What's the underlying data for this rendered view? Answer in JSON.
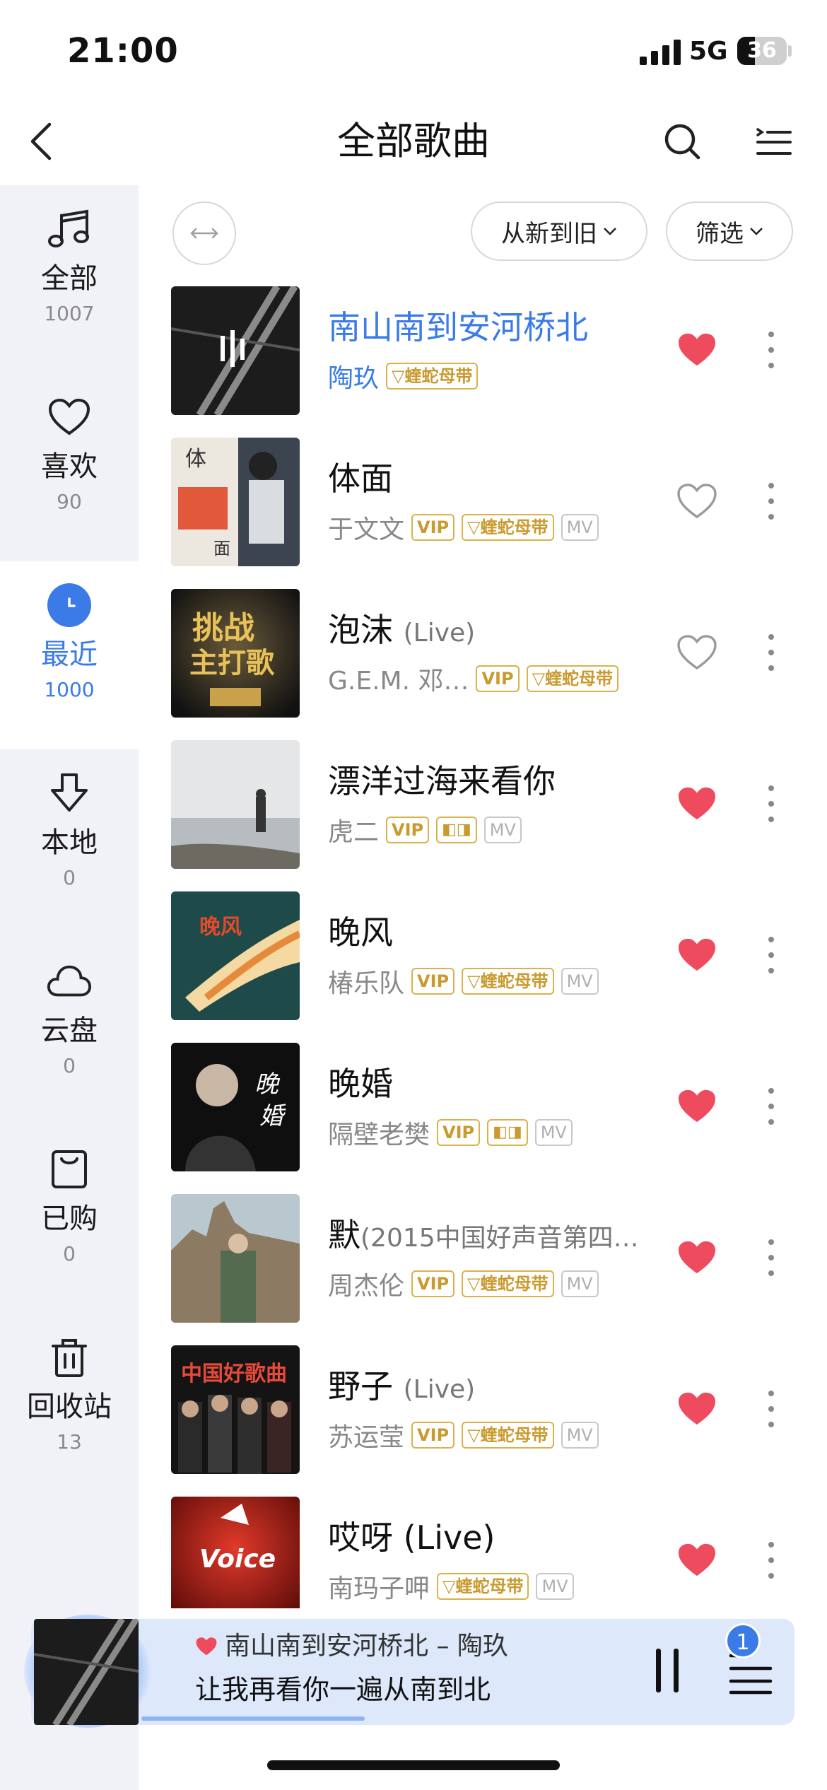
{
  "status_bar": {
    "time": "21:00",
    "network": "5G",
    "battery": "36"
  },
  "header": {
    "title": "全部歌曲",
    "back_icon": "chevron-left-icon",
    "search_icon": "search-icon",
    "menu_icon": "list-menu-icon"
  },
  "sidebar": {
    "items": [
      {
        "label": "全部",
        "count": "1007",
        "icon": "music-note-icon"
      },
      {
        "label": "喜欢",
        "count": "90",
        "icon": "heart-outline-icon"
      },
      {
        "label": "最近",
        "count": "1000",
        "icon": "clock-icon",
        "active": true
      },
      {
        "label": "本地",
        "count": "0",
        "icon": "download-arrow-icon"
      },
      {
        "label": "云盘",
        "count": "0",
        "icon": "cloud-icon"
      },
      {
        "label": "已购",
        "count": "0",
        "icon": "bag-icon"
      },
      {
        "label": "回收站",
        "count": "13",
        "icon": "trash-icon"
      }
    ]
  },
  "toolbar": {
    "expand_icon": "expand-arrows-icon",
    "sort_label": "从新到旧",
    "filter_label": "筛选"
  },
  "badges": {
    "vip": "VIP",
    "viper": "蝰蛇母带",
    "mv": "MV"
  },
  "songs": [
    {
      "title": "南山南到安河桥北",
      "subtitle": "",
      "artist": "陶玖",
      "liked": true,
      "playing": true
    },
    {
      "title": "体面",
      "subtitle": "",
      "artist": "于文文",
      "liked": false
    },
    {
      "title": "泡沫",
      "subtitle": "(Live)",
      "artist": "G.E.M. 邓…",
      "liked": false
    },
    {
      "title": "漂洋过海来看你",
      "subtitle": "",
      "artist": "虎二",
      "liked": true
    },
    {
      "title": "晚风",
      "subtitle": "",
      "artist": "椿乐队",
      "liked": true
    },
    {
      "title": "晚婚",
      "subtitle": "",
      "artist": "隔壁老樊",
      "liked": true
    },
    {
      "title": "默",
      "subtitle": "(2015中国好声音第四…",
      "artist": "周杰伦",
      "liked": true
    },
    {
      "title": "野子",
      "subtitle": "(Live)",
      "artist": "苏运莹",
      "liked": true
    },
    {
      "title": "哎呀 (Live)",
      "subtitle": "",
      "artist": "南玛子呷",
      "liked": true
    }
  ],
  "player": {
    "song": "南山南到安河桥北 – 陶玖",
    "lyric": "让我再看你一遍从南到北",
    "queue_count": "1",
    "progress": 0.2
  },
  "colors": {
    "accent": "#3a7be8",
    "heart": "#ef4b5e",
    "gold": "#c99a2e",
    "sidebar_bg": "#f1f2f7"
  }
}
